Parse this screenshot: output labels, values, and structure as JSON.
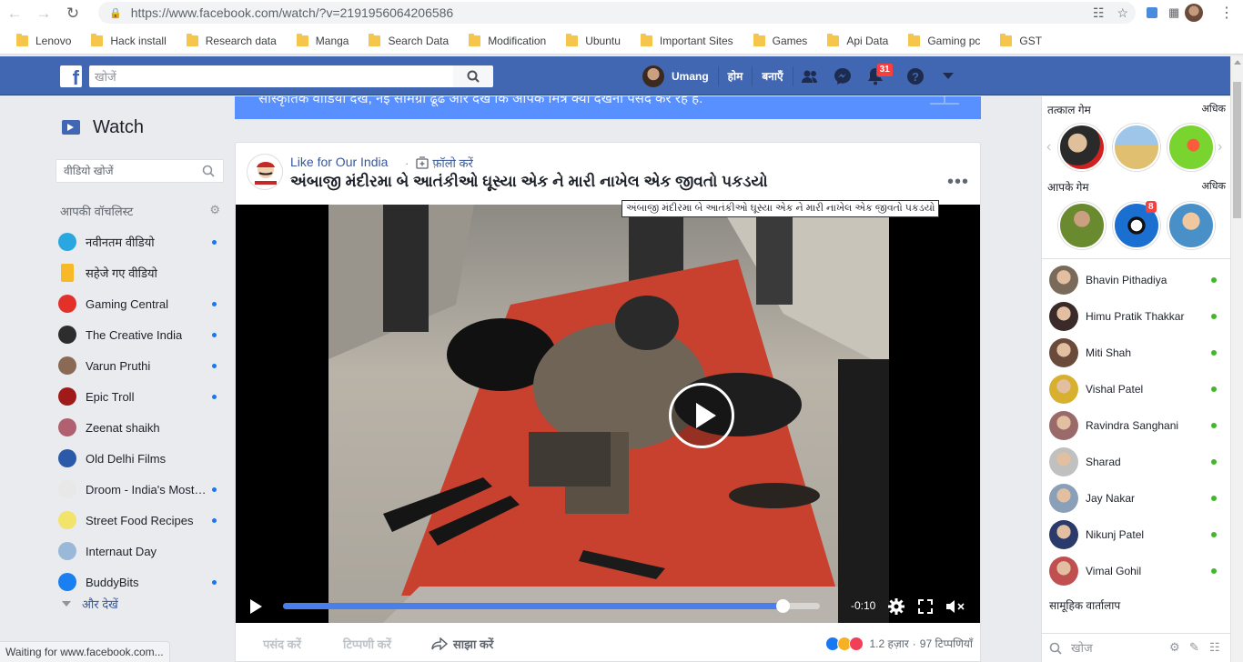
{
  "browser": {
    "url": "https://www.facebook.com/watch/?v=2191956064206586",
    "bookmarks": [
      "Lenovo",
      "Hack install",
      "Research data",
      "Manga",
      "Search Data",
      "Modification",
      "Ubuntu",
      "Important Sites",
      "Games",
      "Api Data",
      "Gaming pc",
      "GST"
    ],
    "status": "Waiting for www.facebook.com..."
  },
  "fb_header": {
    "search_placeholder": "खोजें",
    "user_name": "Umang",
    "home_label": "होम",
    "create_label": "बनाएँ",
    "notification_count": "31"
  },
  "left": {
    "title": "Watch",
    "search_placeholder": "वीडियो खोजें",
    "watchlist_heading": "आपकी वॉचलिस्ट",
    "items": [
      {
        "label": "नवीनतम वीडियो",
        "color": "#29a7e1",
        "dot": true
      },
      {
        "label": "सहेजे गए वीडियो",
        "color": "#f7b928",
        "dot": false
      },
      {
        "label": "Gaming Central",
        "color": "#e4302a",
        "dot": true
      },
      {
        "label": "The Creative India",
        "color": "#2d2d2d",
        "dot": true
      },
      {
        "label": "Varun Pruthi",
        "color": "#8a6a55",
        "dot": true
      },
      {
        "label": "Epic Troll",
        "color": "#a01a1a",
        "dot": true
      },
      {
        "label": "Zeenat shaikh",
        "color": "#b06070",
        "dot": false
      },
      {
        "label": "Old Delhi Films",
        "color": "#2b5aa8",
        "dot": false
      },
      {
        "label": "Droom - India's Most Trusted",
        "color": "#e8e8e8",
        "dot": true
      },
      {
        "label": "Street Food Recipes",
        "color": "#f2e46a",
        "dot": true
      },
      {
        "label": "Internaut Day",
        "color": "#9ab8d8",
        "dot": false
      },
      {
        "label": "BuddyBits",
        "color": "#1a7ff0",
        "dot": true
      }
    ],
    "see_more": "और देखें"
  },
  "banner": {
    "text": "सांस्कृतिक वीडियो देखें, नई सामग्री ढूंढें और देखें कि आपके मित्र क्या देखना पसंद कर रहे हैं."
  },
  "post": {
    "page_name": "Like for Our India",
    "follow_label": "फ़ॉलो करें",
    "title": "અંબાજી મંદીરમા બે આતંકીઓ ઘૂસ્યા એક ને મારી નાખેલ એક જીવતો પકડયો",
    "tooltip": "અંબાજી મંદીરમા બે આતંકીઓ ઘૂસ્યા એક ને મારી નાખેલ એક જીવતો પકડયો",
    "time_remaining": "-0:10",
    "progress": 0.93,
    "share_label": "साझा करें",
    "like_label": "पसंद करें",
    "comment_label": "टिप्पणी करें",
    "reactions_count": "1.2 हज़ार",
    "comments_count": "97 टिप्पणियाँ"
  },
  "right": {
    "instant_games": "तत्काल गेम",
    "your_games": "आपके गेम",
    "more_label": "अधिक",
    "game_badge": "8",
    "friends": [
      {
        "name": "Bhavin Pithadiya",
        "color": "#7a6a5a"
      },
      {
        "name": "Himu Pratik Thakkar",
        "color": "#3a2a2a"
      },
      {
        "name": "Miti Shah",
        "color": "#6a4a3a"
      },
      {
        "name": "Vishal Patel",
        "color": "#d8b030"
      },
      {
        "name": "Ravindra Sanghani",
        "color": "#9a6a6a"
      },
      {
        "name": "Sharad",
        "color": "#c0c0c0"
      },
      {
        "name": "Jay Nakar",
        "color": "#8aa0b8"
      },
      {
        "name": "Nikunj Patel",
        "color": "#2a3a6a"
      },
      {
        "name": "Vimal Gohil",
        "color": "#c05050"
      }
    ],
    "group_conversations": "सामूहिक वार्तालाप",
    "chat_search_placeholder": "खोज"
  }
}
